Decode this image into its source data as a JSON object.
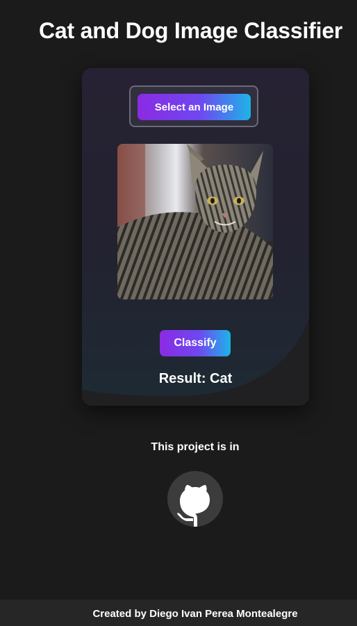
{
  "header": {
    "title": "Cat and Dog Image Classifier"
  },
  "uploader": {
    "select_label": "Select an Image",
    "preview_alt": "cat image preview"
  },
  "classifier": {
    "classify_label": "Classify",
    "result_text": "Result: Cat"
  },
  "project": {
    "text": "This project is in",
    "icon": "github-icon"
  },
  "footer": {
    "text": "Created by Diego Ivan Perea Montealegre"
  },
  "colors": {
    "page_bg": "#1b1b1b",
    "card_bg": "#1f1f22",
    "button_gradient_start": "#8a2be2",
    "button_gradient_end": "#1db4e8",
    "footer_bg": "#262626",
    "github_circle": "#3c3c3c"
  }
}
